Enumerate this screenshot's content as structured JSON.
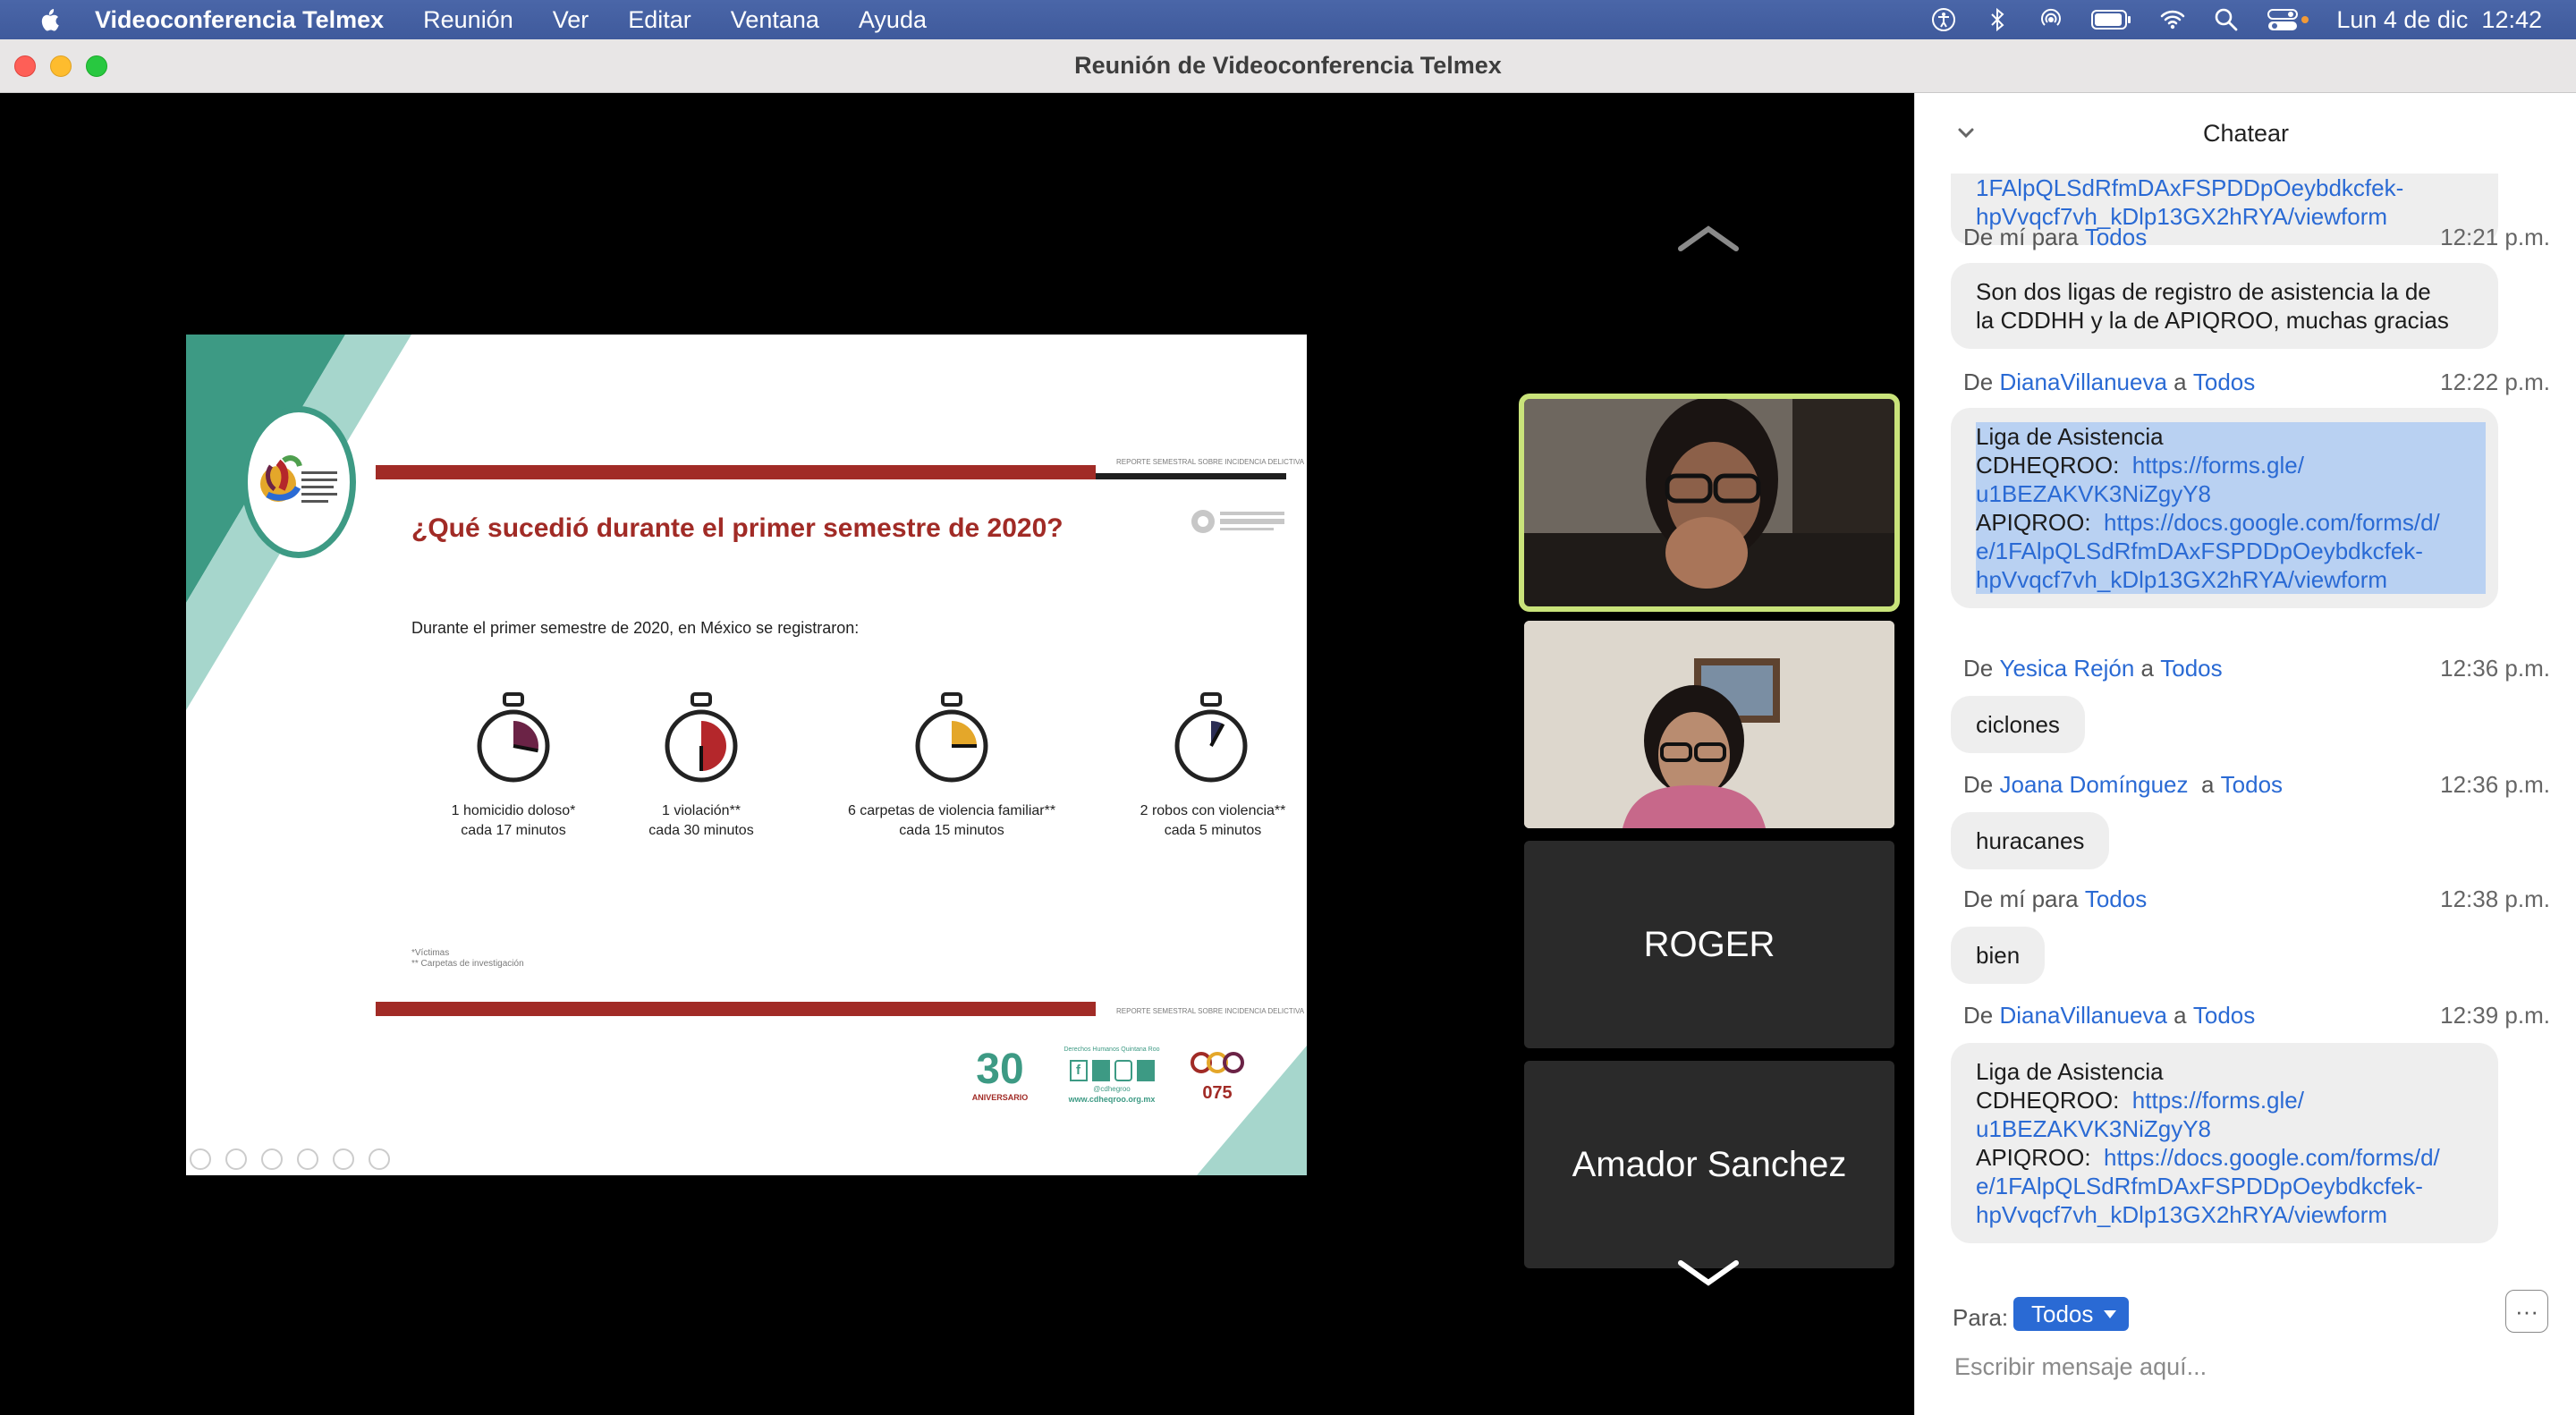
{
  "menubar": {
    "app": "Videoconferencia Telmex",
    "items": [
      "Reunión",
      "Ver",
      "Editar",
      "Ventana",
      "Ayuda"
    ],
    "datetime": "Lun 4 de dic  12:42"
  },
  "window": {
    "title": "Reunión de Videoconferencia Telmex"
  },
  "slide": {
    "title": "¿Qué sucedió durante el primer semestre de 2020?",
    "intro": "Durante el primer semestre de 2020, en México se registraron:",
    "report_label": "REPORTE SEMESTRAL SOBRE INCIDENCIA DELICTIVA",
    "stats": [
      {
        "line1": "1 homicidio doloso*",
        "line2": "cada 17 minutos",
        "fill": 0.28,
        "color": "#6b2346"
      },
      {
        "line1": "1 violación**",
        "line2": "cada 30 minutos",
        "fill": 0.5,
        "color": "#b4272b"
      },
      {
        "line1": "6 carpetas de violencia familiar**",
        "line2": "cada 15 minutos",
        "fill": 0.25,
        "color": "#e4a72a"
      },
      {
        "line1": "2 robos con violencia**",
        "line2": "cada 5 minutos",
        "fill": 0.08,
        "color": "#2b2d55"
      }
    ],
    "footnote1": "*Víctimas",
    "footnote2": "** Carpetas de investigación",
    "anniv": "30",
    "anniv_label": "ANIVERSARIO",
    "social_title": "Derechos Humanos Quintana Roo",
    "social_handle": "@cdhegroo",
    "social_web": "www.cdheqroo.org.mx",
    "line_number": "075"
  },
  "participants": [
    {
      "name": "ROGER"
    },
    {
      "name": "Amador Sanchez"
    }
  ],
  "chat": {
    "title": "Chatear",
    "top_bubble": {
      "line1": "1FAlpQLSdRfmDAxFSPDDpOeybdkcfek-",
      "line2": "hpVvqcf7vh_kDlp13GX2hRYA/viewform"
    },
    "messages": [
      {
        "from_prefix": "De mí para",
        "from": "",
        "to": "Todos",
        "time": "12:21 p.m.",
        "lines": [
          "Son dos ligas de registro de asistencia la de",
          "la CDDHH y la de APIQROO, muchas gracias"
        ]
      },
      {
        "from_prefix": "De",
        "from": "DianaVillanueva",
        "to": "Todos",
        "time": "12:22 p.m."
      },
      {
        "from_prefix": "De",
        "from": "Yesica Rejón",
        "to": "Todos",
        "time": "12:36 p.m.",
        "lines": [
          "ciclones"
        ]
      },
      {
        "from_prefix": "De",
        "from": "Joana Domínguez ",
        "to": "Todos",
        "time": "12:36 p.m.",
        "lines": [
          "huracanes"
        ]
      },
      {
        "from_prefix": "De mí para",
        "from": "",
        "to": "Todos",
        "time": "12:38 p.m.",
        "lines": [
          "bien"
        ]
      },
      {
        "from_prefix": "De",
        "from": "DianaVillanueva",
        "to": "Todos",
        "time": "12:39 p.m."
      }
    ],
    "liga": {
      "title": "Liga de Asistencia",
      "cdheqroo_label": "CDHEQROO:",
      "cdheqroo_link1": "https://forms.gle/",
      "cdheqroo_link2": "u1BEZAKVK3NiZgyY8",
      "apiqroo_label": "APIQROO:",
      "apiqroo_link1": "https://docs.google.com/forms/d/",
      "apiqroo_link2": "e/1FAlpQLSdRfmDAxFSPDDpOeybdkcfek-",
      "apiqroo_link3": "hpVvqcf7vh_kDlp13GX2hRYA/viewform"
    },
    "a_word": "a",
    "para_label": "Para:",
    "recipient": "Todos",
    "more_label": "···",
    "input_placeholder": "Escribir mensaje aquí..."
  }
}
